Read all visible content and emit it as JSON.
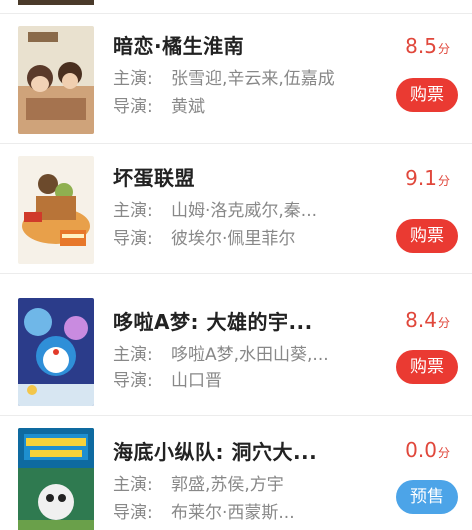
{
  "labels": {
    "star": "主演:",
    "director": "导演:"
  },
  "movies": [
    {
      "title": "暗恋·橘生淮南",
      "score": "8.5",
      "score_unit": "分",
      "stars": "张雪迎,辛云来,伍嘉成",
      "director": "黄斌",
      "button": "购票",
      "button_type": "buy"
    },
    {
      "title": "坏蛋联盟",
      "score": "9.1",
      "score_unit": "分",
      "stars": "山姆·洛克威尔,秦...",
      "director": "彼埃尔·佩里菲尔",
      "button": "购票",
      "button_type": "buy"
    },
    {
      "title": "哆啦A梦: 大雄的宇...",
      "score": "8.4",
      "score_unit": "分",
      "stars": "哆啦A梦,水田山葵,...",
      "director": "山口晋",
      "button": "购票",
      "button_type": "buy"
    },
    {
      "title": "海底小纵队: 洞穴大...",
      "score": "0.0",
      "score_unit": "分",
      "stars": "郭盛,苏侯,方宇",
      "director": "布莱尔·西蒙斯...",
      "button": "预售",
      "button_type": "presale"
    }
  ],
  "colors": {
    "price_red": "#e0473b",
    "buy_button": "#ea3a32",
    "presale_button": "#4ca4e8"
  },
  "icons": [
    "poster-image"
  ]
}
